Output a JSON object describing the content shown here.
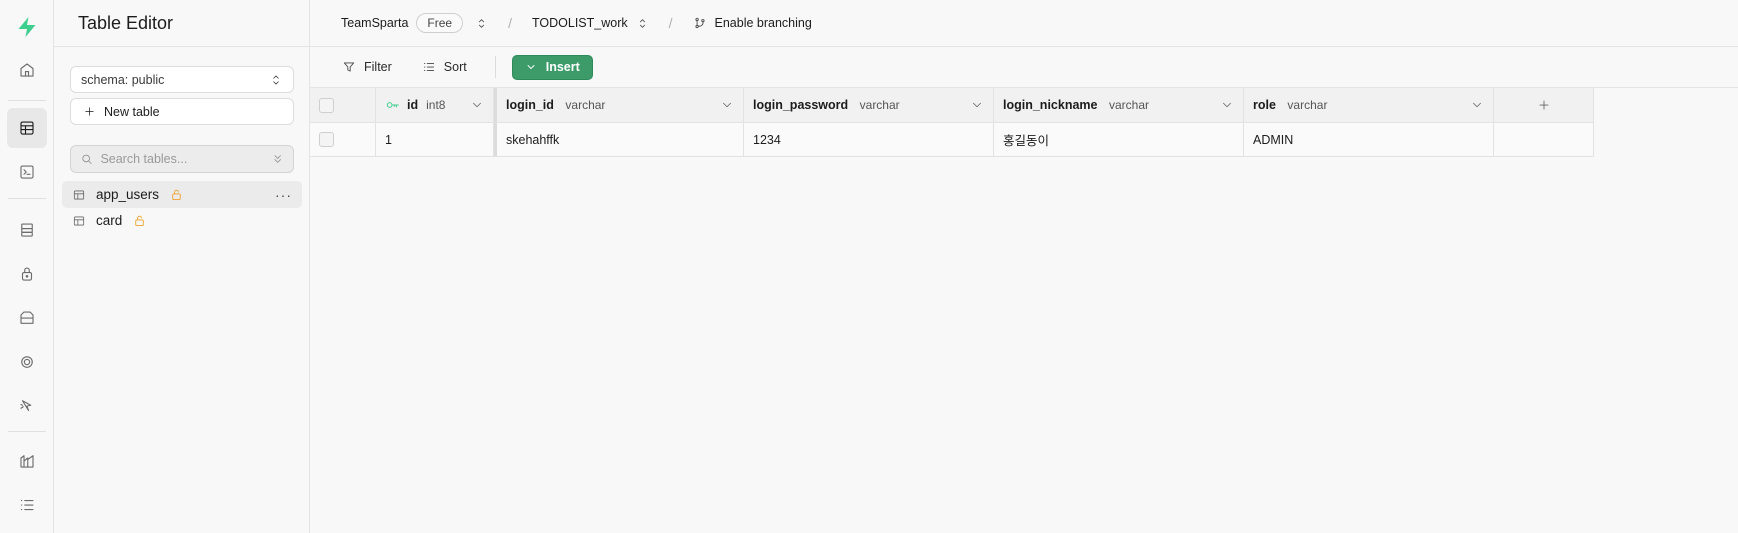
{
  "sidebar": {
    "title": "Table Editor",
    "schema_label": "schema: public",
    "new_table_label": "New table",
    "search_placeholder": "Search tables...",
    "tables": [
      {
        "name": "app_users",
        "active": true
      },
      {
        "name": "card",
        "active": false
      }
    ]
  },
  "topbar": {
    "org": "TeamSparta",
    "plan": "Free",
    "project": "TODOLIST_work",
    "branching": "Enable branching"
  },
  "toolbar": {
    "filter_label": "Filter",
    "sort_label": "Sort",
    "insert_label": "Insert"
  },
  "grid": {
    "columns": [
      {
        "name": "id",
        "type": "int8",
        "primary_key": true
      },
      {
        "name": "login_id",
        "type": "varchar"
      },
      {
        "name": "login_password",
        "type": "varchar"
      },
      {
        "name": "login_nickname",
        "type": "varchar"
      },
      {
        "name": "role",
        "type": "varchar"
      }
    ],
    "rows": [
      [
        "1",
        "skehahffk",
        "1234",
        "홍길동이",
        "ADMIN"
      ]
    ]
  },
  "colors": {
    "brand": "#3ecf8e",
    "insert_button": "#3d9b6a",
    "lock_icon": "#f0a028"
  }
}
